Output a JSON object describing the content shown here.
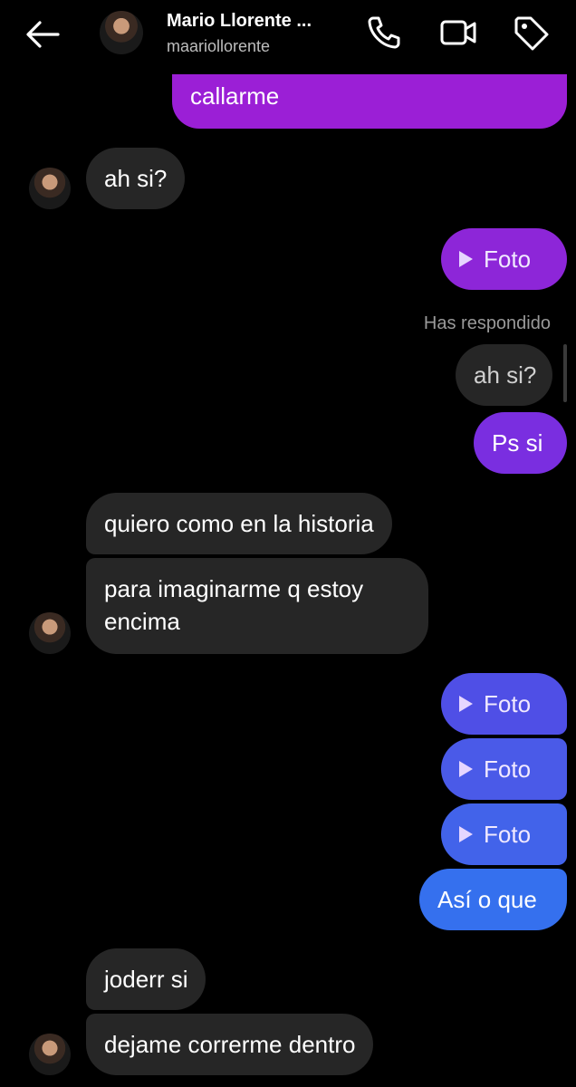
{
  "header": {
    "name": "Mario Llorente ...",
    "username": "maariollorente",
    "back_icon": "arrow-left-icon",
    "call_icon": "phone-icon",
    "video_icon": "video-camera-icon",
    "tag_icon": "tag-icon"
  },
  "messages": {
    "m0": "callarme",
    "m1": "ah si?",
    "m2": "Foto",
    "m3_status": "Has respondido",
    "m3_reply": "ah si?",
    "m4": "Ps si",
    "m5": "quiero como en la historia",
    "m6": "para imaginarme q estoy encima",
    "m7": "Foto",
    "m8": "Foto",
    "m9": "Foto",
    "m10": "Así o que",
    "m11": "joderr si",
    "m12": "dejame correrme dentro"
  },
  "colors": {
    "background": "#000000",
    "received_bubble": "#262626",
    "sent_purple": "#9b1fd6",
    "sent_violet": "#7a2ee0",
    "sent_indigo": "#4c58e6",
    "sent_blue": "#3570ee"
  }
}
